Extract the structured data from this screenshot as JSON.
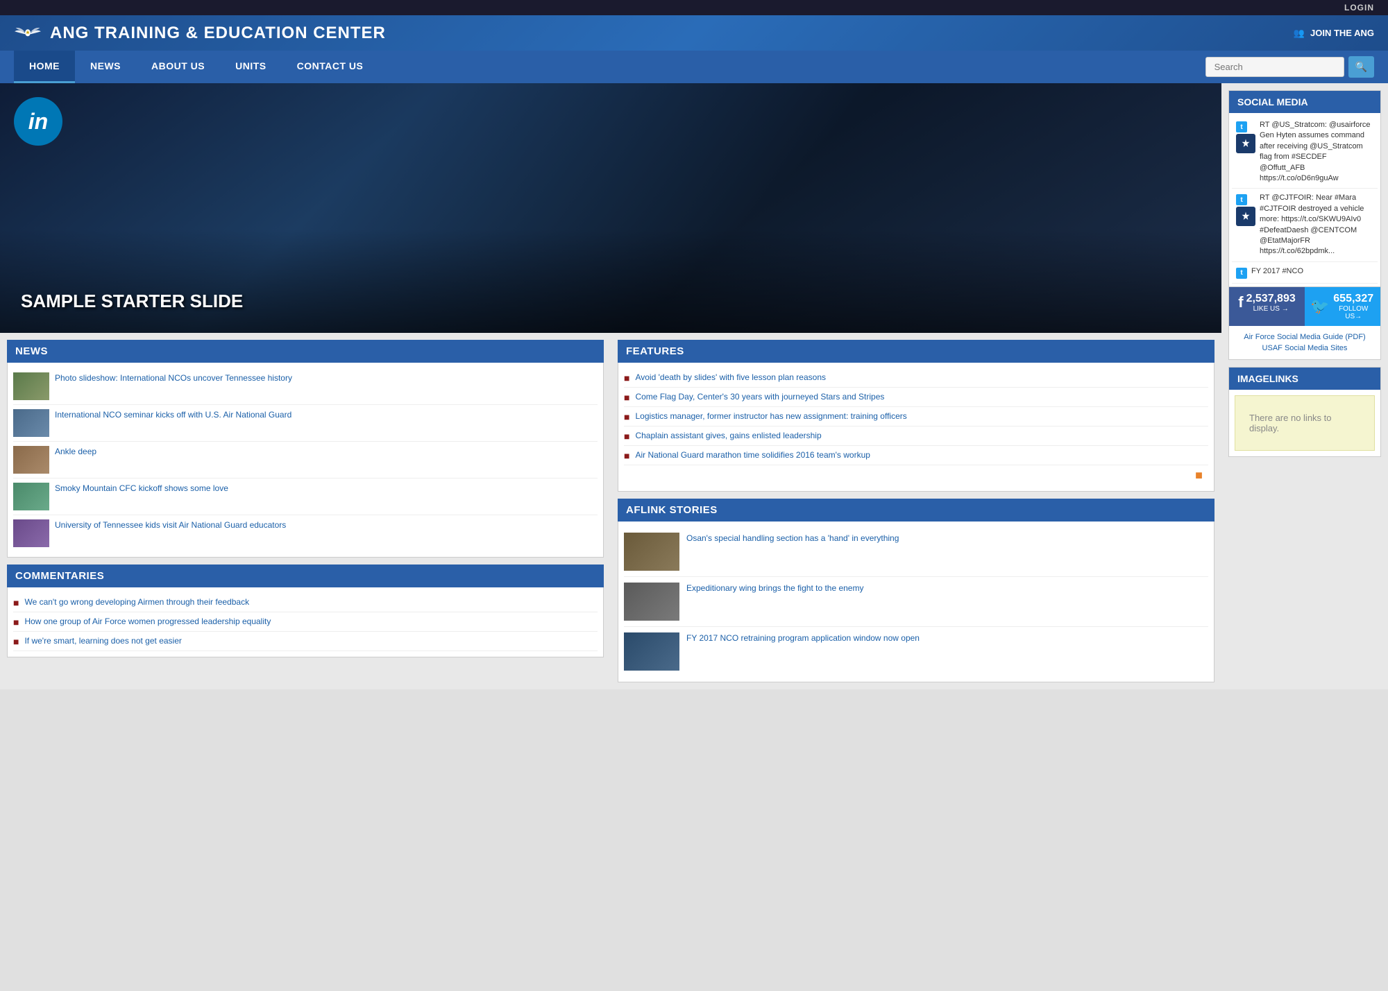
{
  "topbar": {
    "login_label": "LOGIN"
  },
  "header": {
    "title": "ANG TRAINING & EDUCATION CENTER",
    "join_label": "JOIN THE ANG",
    "logo_alt": "Air Force Wings Logo"
  },
  "nav": {
    "items": [
      {
        "label": "HOME",
        "active": true
      },
      {
        "label": "NEWS",
        "active": false
      },
      {
        "label": "ABOUT US",
        "active": false
      },
      {
        "label": "UNITS",
        "active": false
      },
      {
        "label": "CONTACT US",
        "active": false
      }
    ],
    "search_placeholder": "Search"
  },
  "hero": {
    "linkedin_label": "in",
    "slide_text": "SAMPLE STARTER SLIDE"
  },
  "news_section": {
    "title": "NEWS",
    "items": [
      {
        "thumb_class": "t1",
        "link": "Photo slideshow: International NCOs uncover Tennessee history"
      },
      {
        "thumb_class": "t2",
        "link": "International NCO seminar kicks off with U.S. Air National Guard"
      },
      {
        "thumb_class": "t3",
        "link": "Ankle deep"
      },
      {
        "thumb_class": "t4",
        "link": "Smoky Mountain CFC kickoff shows some love"
      },
      {
        "thumb_class": "t5",
        "link": "University of Tennessee kids visit Air National Guard educators"
      }
    ]
  },
  "features_section": {
    "title": "FEATURES",
    "items": [
      {
        "link": "Avoid 'death by slides' with five lesson plan reasons"
      },
      {
        "link": "Come Flag Day, Center's 30 years with journeyed Stars and Stripes"
      },
      {
        "link": "Logistics manager, former instructor has new assignment: training officers"
      },
      {
        "link": "Chaplain assistant gives, gains enlisted leadership"
      },
      {
        "link": "Air National Guard marathon time solidifies 2016 team's workup"
      }
    ]
  },
  "commentaries_section": {
    "title": "COMMENTARIES",
    "items": [
      {
        "link": "We can't go wrong developing Airmen through their feedback"
      },
      {
        "link": "How one group of Air Force women progressed leadership equality"
      },
      {
        "link": "If we're smart, learning does not get easier"
      }
    ]
  },
  "aflink_section": {
    "title": "AFLINK STORIES",
    "items": [
      {
        "thumb_class": "a1",
        "link": "Osan's special handling section has a 'hand' in everything"
      },
      {
        "thumb_class": "a2",
        "link": "Expeditionary wing brings the fight to the enemy"
      },
      {
        "thumb_class": "a3",
        "link": "FY 2017 NCO retraining program application window now open"
      }
    ]
  },
  "social_media": {
    "title": "SOCIAL MEDIA",
    "tweets": [
      {
        "text": "RT @US_Stratcom: @usairforce Gen Hyten assumes command after receiving @US_Stratcom flag from #SECDEF @Offutt_AFB https://t.co/oD6n9guAw"
      },
      {
        "text": "RT @CJTFOIR: Near #Mara #CJTFOIR destroyed a vehicle more: https://t.co/SKWU9AIv0 #DefeatDaesh @CENTCOM @EtatMajorFR https://t.co/62bpdmk..."
      },
      {
        "text": "FY 2017 #NCO"
      }
    ],
    "facebook": {
      "count": "2,537,893",
      "label": "LIKE US →"
    },
    "twitter": {
      "count": "655,327",
      "label": "FOLLOW US→"
    },
    "links": [
      {
        "label": "Air Force Social Media Guide (PDF)"
      },
      {
        "label": "USAF Social Media Sites"
      }
    ]
  },
  "imagelinks": {
    "title": "IMAGELINKS",
    "empty_text": "There are no links to display."
  }
}
